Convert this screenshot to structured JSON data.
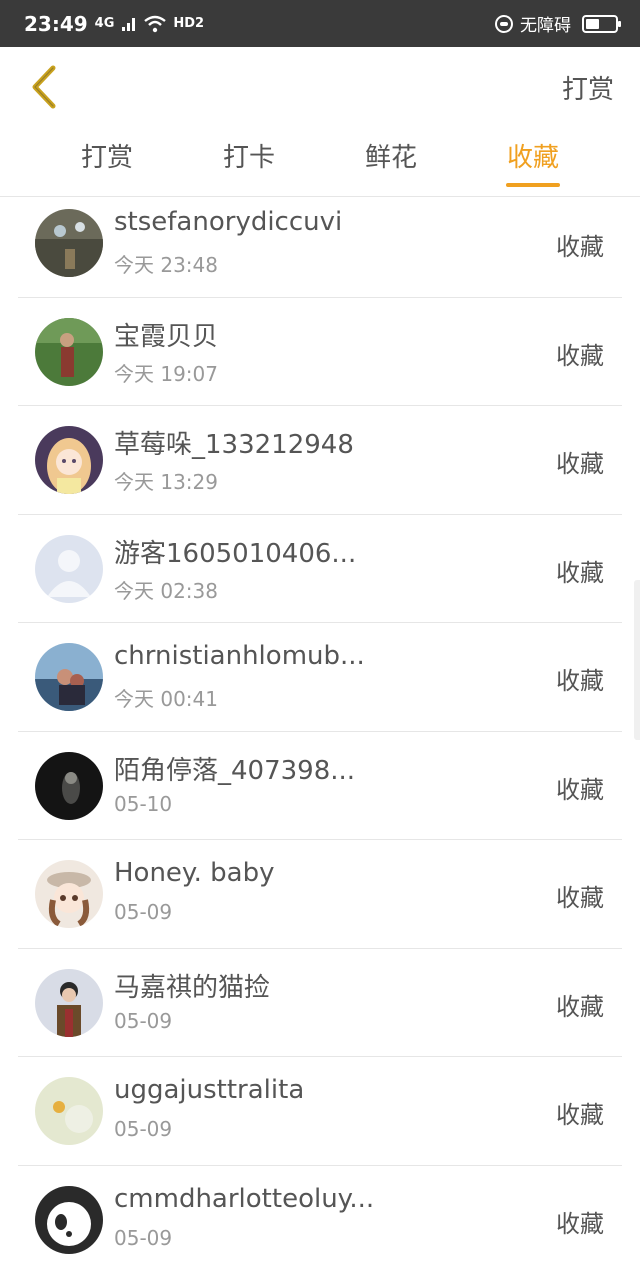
{
  "status_bar": {
    "time": "23:49",
    "network": "4G",
    "hd": "HD2",
    "accessibility": "无障碍",
    "battery_level": 0.45
  },
  "header": {
    "back_icon": "chevron-left-icon",
    "action_label": "打赏"
  },
  "colors": {
    "accent": "#f0a020",
    "text": "#555555",
    "secondary_text": "#999999"
  },
  "tabs": [
    {
      "label": "打赏",
      "active": false
    },
    {
      "label": "打卡",
      "active": false
    },
    {
      "label": "鲜花",
      "active": false
    },
    {
      "label": "收藏",
      "active": true
    }
  ],
  "items": [
    {
      "name": "stsefanorydiccuvi",
      "time": "今天 23:48",
      "action": "收藏"
    },
    {
      "name": "宝霞贝贝",
      "time": "今天 19:07",
      "action": "收藏"
    },
    {
      "name": "草莓哚_133212948",
      "time": "今天 13:29",
      "action": "收藏"
    },
    {
      "name": "游客1605010406...",
      "time": "今天 02:38",
      "action": "收藏"
    },
    {
      "name": "chrnistianhlomub...",
      "time": "今天 00:41",
      "action": "收藏"
    },
    {
      "name": "陌角停落_407398...",
      "time": "05-10",
      "action": "收藏"
    },
    {
      "name": "Honey. baby",
      "time": "05-09",
      "action": "收藏"
    },
    {
      "name": "马嘉祺的猫捡",
      "time": "05-09",
      "action": "收藏"
    },
    {
      "name": "uggajusttralita",
      "time": "05-09",
      "action": "收藏"
    },
    {
      "name": "cmmdharlotteoluy...",
      "time": "05-09",
      "action": "收藏"
    }
  ]
}
